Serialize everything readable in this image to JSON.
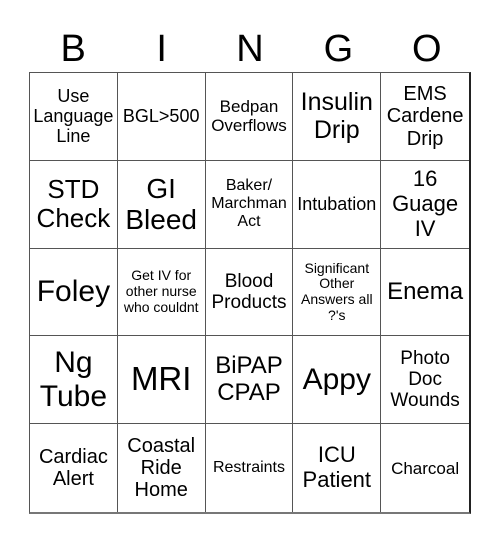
{
  "header": {
    "letters": [
      "B",
      "I",
      "N",
      "G",
      "O"
    ]
  },
  "board": {
    "rows": [
      [
        "Use Language Line",
        "BGL>500",
        "Bedpan Overflows",
        "Insulin Drip",
        "EMS Cardene Drip"
      ],
      [
        "STD Check",
        "GI Bleed",
        "Baker/ Marchman Act",
        "Intubation",
        "16 Guage IV"
      ],
      [
        "Foley",
        "Get IV for other nurse who couldnt",
        "Blood Products",
        "Significant Other Answers all ?'s",
        "Enema"
      ],
      [
        "Ng Tube",
        "MRI",
        "BiPAP CPAP",
        "Appy",
        "Photo Doc Wounds"
      ],
      [
        "Cardiac Alert",
        "Coastal Ride Home",
        "Restraints",
        "ICU Patient",
        "Charcoal"
      ]
    ]
  }
}
